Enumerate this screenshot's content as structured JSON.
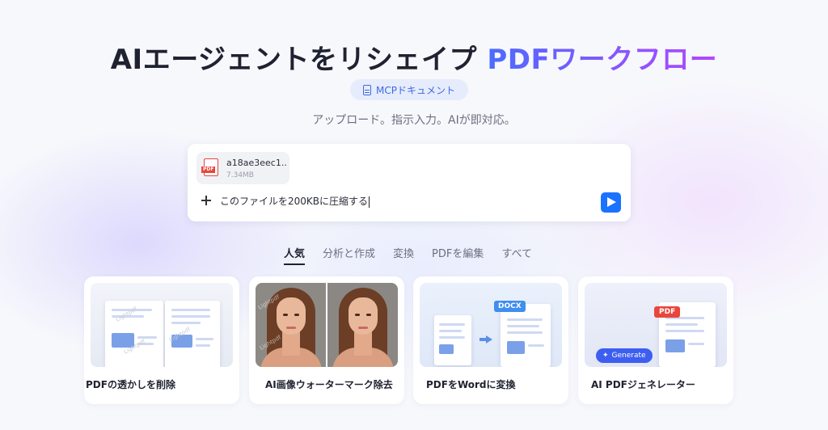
{
  "hero": {
    "title_main": "AIエージェントをリシェイプ",
    "title_accent": "PDFワークフロー",
    "mcp_badge": "MCPドキュメント",
    "subtitle": "アップロード。指示入力。AIが即対応。"
  },
  "chat": {
    "attachment": {
      "name": "a18ae3eec1...",
      "size": "7.34MB",
      "type_tag": "PDF"
    },
    "prompt_value": "このファイルを200KBに圧縮する"
  },
  "tabs": [
    {
      "label": "人気",
      "active": true
    },
    {
      "label": "分析と作成",
      "active": false
    },
    {
      "label": "変換",
      "active": false
    },
    {
      "label": "PDFを編集",
      "active": false
    },
    {
      "label": "すべて",
      "active": false
    }
  ],
  "cards": [
    {
      "title": "PDFの透かしを削除",
      "watermark_text": "Lightpdf"
    },
    {
      "title": "AI画像ウォーターマーク除去",
      "watermark_text": "Lightpdf"
    },
    {
      "title": "PDFをWordに変換",
      "tag": "DOCX"
    },
    {
      "title": "AI PDFジェネレーター",
      "tag": "PDF",
      "button": "Generate"
    }
  ],
  "colors": {
    "accent_start": "#4c6bff",
    "accent_end": "#b347ff",
    "send_button": "#1a73ff",
    "pdf_red": "#e8453c"
  }
}
